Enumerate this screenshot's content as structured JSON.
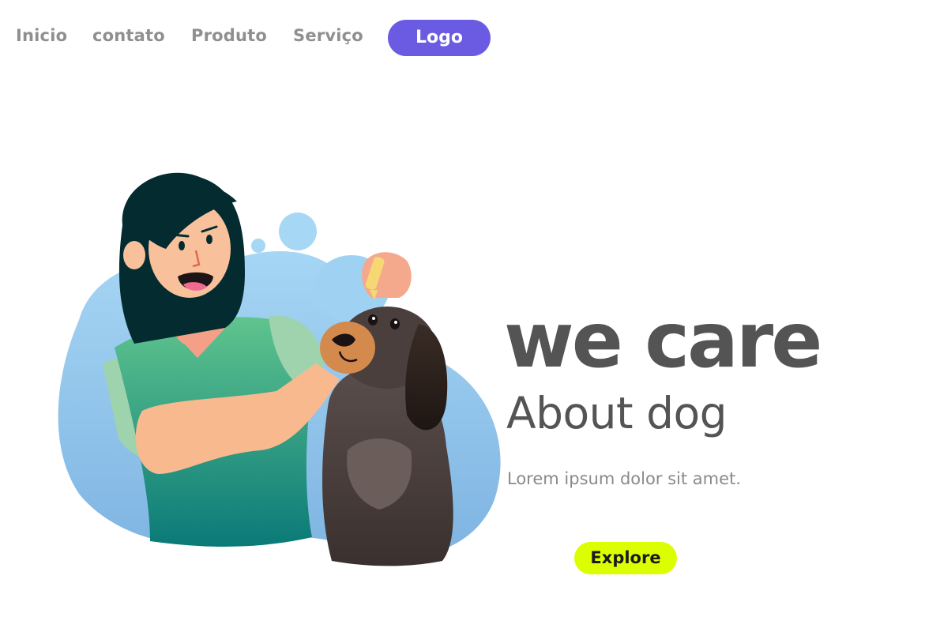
{
  "nav": {
    "items": [
      {
        "label": "Inicio"
      },
      {
        "label": "contato"
      },
      {
        "label": "Produto"
      },
      {
        "label": "Serviço"
      }
    ],
    "logo_label": "Logo"
  },
  "hero": {
    "title": "we care",
    "subtitle": "About dog",
    "text": "Lorem ipsum dolor sit amet.",
    "cta_label": "Explore"
  },
  "colors": {
    "nav_text": "#8f8f8f",
    "logo_bg": "#6a5be2",
    "heading": "#545454",
    "body_text": "#8a8a8a",
    "cta_bg": "#dcff00",
    "blob": "#8ec8ee"
  },
  "illustration": {
    "icons": [
      "woman-figure",
      "dog-figure",
      "dropper-icon",
      "bubble-blob"
    ]
  }
}
